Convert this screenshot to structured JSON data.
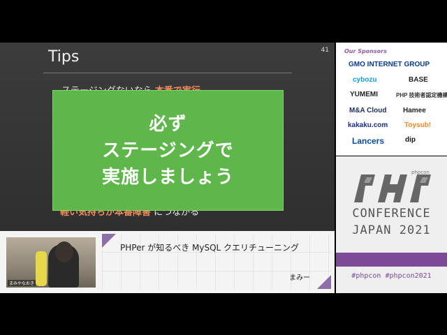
{
  "slide": {
    "title": "Tips",
    "number": "41",
    "text_top_plain": "ステージングないなら",
    "text_top_highlight": "本番で実行",
    "text_bottom_highlight": "軽い気持ちが本番障害",
    "text_bottom_plain": "につながる",
    "callout_lines": [
      "必ず",
      "ステージングで",
      "実施しましょう"
    ],
    "colors": {
      "callout": "#5fb64a",
      "highlight": "#f28a5a"
    }
  },
  "speaker": {
    "camera_label": "まみやなおき",
    "talk_title": "PHPer が知るべき MySQL クエリチューニング",
    "name": "まみー"
  },
  "sponsors": {
    "heading": "Our Sponsors",
    "logos": [
      {
        "name": "GMO INTERNET GROUP",
        "color": "#0a3a8c"
      },
      {
        "name": "cybozu",
        "color": "#1a9ad6"
      },
      {
        "name": "BASE",
        "color": "#222222"
      },
      {
        "name": "YUMEMI",
        "color": "#222222"
      },
      {
        "name": "PHP 技術者認定機構",
        "color": "#333333"
      },
      {
        "name": "M&A Cloud",
        "color": "#1b2e5a"
      },
      {
        "name": "Hamee",
        "color": "#222222"
      },
      {
        "name": "kakaku.com",
        "color": "#1b2e8c"
      },
      {
        "name": "Toysub!",
        "color": "#f08a2a"
      },
      {
        "name": "Lancers",
        "color": "#0a4a9c"
      },
      {
        "name": "dip",
        "color": "#111111"
      }
    ]
  },
  "conference": {
    "brand": "phpcon",
    "line1": "CONFERENCE",
    "line2": "JAPAN 2021",
    "hashtags": "#phpcon #phpcon2021",
    "accent": "#7c4a96"
  }
}
